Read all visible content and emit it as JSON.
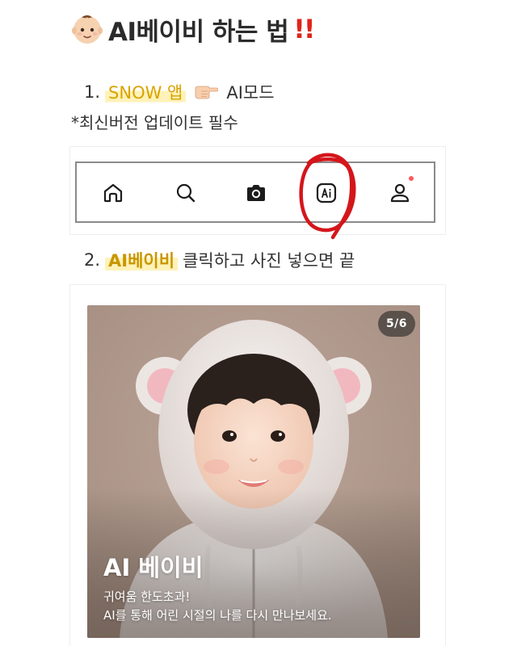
{
  "header": {
    "title": "AI베이비 하는 법",
    "title_suffix": "!!",
    "emoji_icon": "baby-face-emoji",
    "accent_color": "#e0241b"
  },
  "steps": {
    "step1_number": "1.",
    "step1_app": "SNOW 앱",
    "step1_pointer_icon": "backhand-index-pointing-right-emoji",
    "step1_mode": "AI모드",
    "note": "*최신버전 업데이트 필수",
    "step2_number": "2.",
    "step2_target": "AI베이비",
    "step2_rest": "클릭하고 사진 넣으면 끝",
    "highlight_color": "#fff2b8"
  },
  "nav_bar": {
    "items": [
      {
        "icon": "home-icon"
      },
      {
        "icon": "search-icon"
      },
      {
        "icon": "camera-icon"
      },
      {
        "icon": "ai-mode-icon",
        "circled": true
      },
      {
        "icon": "profile-icon",
        "has_notification_dot": true
      }
    ],
    "annotation_color": "#d4161b"
  },
  "card": {
    "page_indicator": "5/6",
    "title": "AI 베이비",
    "line1": "귀여움 한도초과!",
    "line2": "AI를 통해 어린 시절의 나를 다시 만나보세요."
  }
}
